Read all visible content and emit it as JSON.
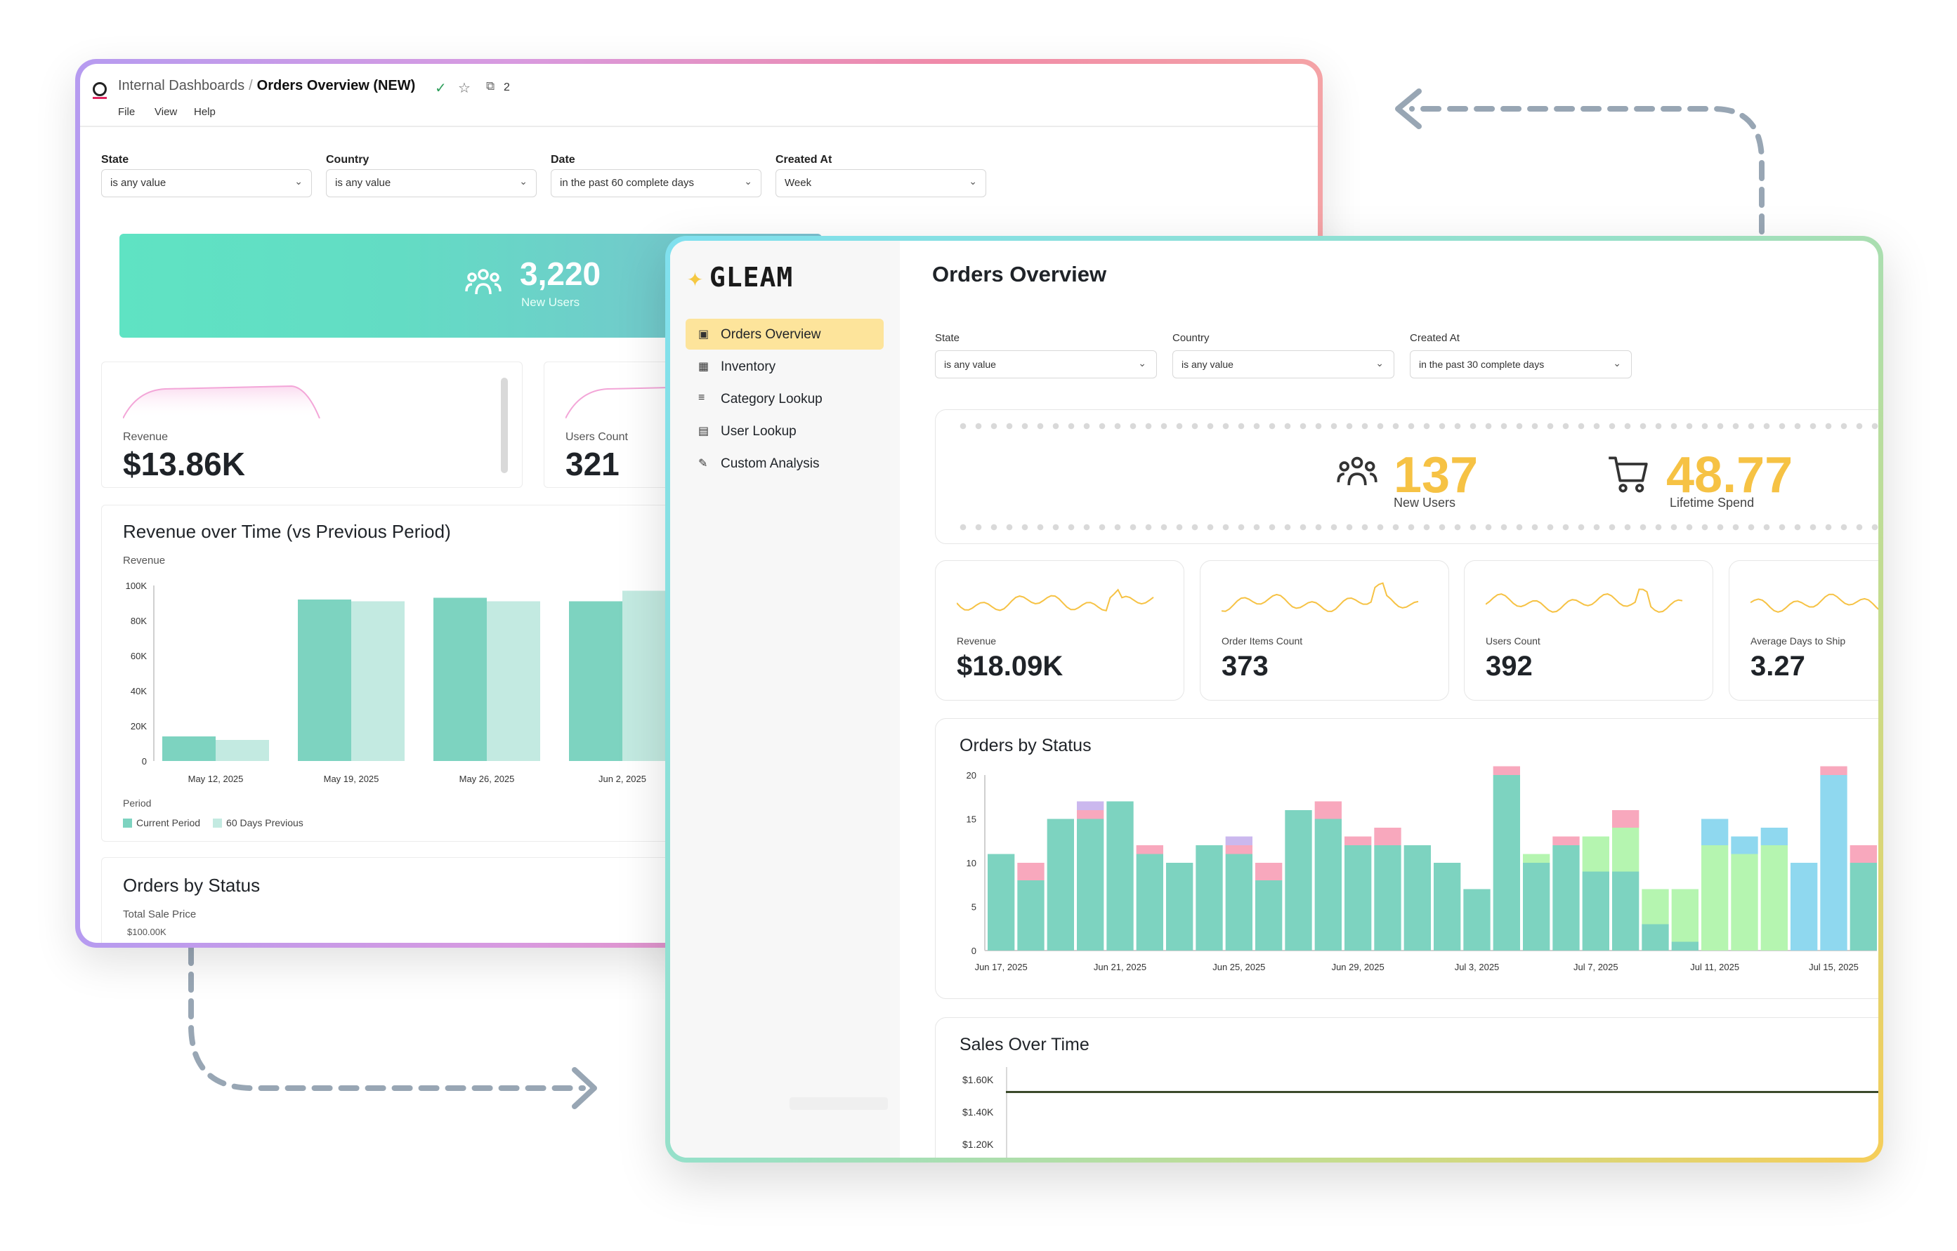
{
  "back_window": {
    "breadcrumb": {
      "parent": "Internal Dashboards",
      "separator": "/",
      "current": "Orders Overview (NEW)"
    },
    "tag_count": "2",
    "menu": [
      "File",
      "View",
      "Help"
    ],
    "filters": [
      {
        "label": "State",
        "value": "is any value"
      },
      {
        "label": "Country",
        "value": "is any value"
      },
      {
        "label": "Date",
        "value": "in the past 60 complete days"
      },
      {
        "label": "Created At",
        "value": "Week"
      }
    ],
    "hero": {
      "value": "3,220",
      "label": "New Users"
    },
    "kpis": [
      {
        "label": "Revenue",
        "value": "$13.86K"
      },
      {
        "label": "Users Count",
        "value": "321"
      }
    ],
    "revenue_chart": {
      "title": "Revenue over Time (vs Previous Period)",
      "ylabel": "Revenue",
      "legend_title": "Period"
    },
    "orders_panel": {
      "title": "Orders by Status",
      "subtitle": "Total Sale Price",
      "tick": "$100.00K"
    }
  },
  "front_window": {
    "brand": "GLEAM",
    "nav": [
      {
        "label": "Orders Overview",
        "icon": "document-icon",
        "active": true
      },
      {
        "label": "Inventory",
        "icon": "boxes-icon",
        "active": false
      },
      {
        "label": "Category Lookup",
        "icon": "list-search-icon",
        "active": false
      },
      {
        "label": "User Lookup",
        "icon": "user-doc-icon",
        "active": false
      },
      {
        "label": "Custom Analysis",
        "icon": "edit-icon",
        "active": false
      }
    ],
    "page_title": "Orders Overview",
    "filters": [
      {
        "label": "State",
        "value": "is any value"
      },
      {
        "label": "Country",
        "value": "is any value"
      },
      {
        "label": "Created At",
        "value": "in the past 30 complete days"
      }
    ],
    "hero": [
      {
        "value": "137",
        "label": "New Users",
        "icon": "users-icon"
      },
      {
        "value": "48.77",
        "label": "Lifetime Spend",
        "icon": "cart-icon"
      }
    ],
    "kpis": [
      {
        "label": "Revenue",
        "value": "$18.09K"
      },
      {
        "label": "Order Items Count",
        "value": "373"
      },
      {
        "label": "Users Count",
        "value": "392"
      },
      {
        "label": "Average Days to Ship",
        "value": "3.27"
      }
    ],
    "orders_panel": {
      "title": "Orders by Status"
    },
    "sales_panel": {
      "title": "Sales Over Time",
      "ticks": [
        "$1.60K",
        "$1.40K",
        "$1.20K"
      ]
    },
    "accent_color": "#f6c244"
  },
  "chart_data": [
    {
      "type": "bar",
      "title": "Revenue over Time (vs Previous Period)",
      "ylabel": "Revenue",
      "xlabel": "Period",
      "categories": [
        "May 12, 2025",
        "May 19, 2025",
        "May 26, 2025",
        "Jun 2, 2025"
      ],
      "ylim": [
        0,
        100000
      ],
      "yticks": [
        "0",
        "20K",
        "40K",
        "60K",
        "80K",
        "100K"
      ],
      "series": [
        {
          "name": "Current Period",
          "color": "#7dd3c0",
          "values": [
            14000,
            92000,
            93000,
            91000
          ]
        },
        {
          "name": "60 Days Previous",
          "color": "#c3eae1",
          "values": [
            12000,
            91000,
            91000,
            97000
          ]
        }
      ],
      "legend": "bottom-left"
    },
    {
      "type": "bar",
      "stacked": true,
      "title": "Orders by Status",
      "ylim": [
        0,
        20
      ],
      "yticks": [
        "0",
        "5",
        "10",
        "15",
        "20"
      ],
      "xtick_labels": [
        "Jun 17, 2025",
        "Jun 21, 2025",
        "Jun 25, 2025",
        "Jun 29, 2025",
        "Jul 3, 2025",
        "Jul 7, 2025",
        "Jul 11, 2025",
        "Jul 15, 2025"
      ],
      "segment_colors": [
        "#7dd3c0",
        "#b5f5b0",
        "#8fd8ef",
        "#f8a8bd",
        "#cbb8ee"
      ],
      "bars": [
        [
          11,
          0,
          0,
          0,
          0
        ],
        [
          8,
          0,
          0,
          2,
          0
        ],
        [
          15,
          0,
          0,
          0,
          0
        ],
        [
          15,
          0,
          0,
          1,
          1
        ],
        [
          17,
          0,
          0,
          0,
          0
        ],
        [
          11,
          0,
          0,
          1,
          0
        ],
        [
          10,
          0,
          0,
          0,
          0
        ],
        [
          12,
          0,
          0,
          0,
          0
        ],
        [
          11,
          0,
          0,
          1,
          1
        ],
        [
          8,
          0,
          0,
          2,
          0
        ],
        [
          16,
          0,
          0,
          0,
          0
        ],
        [
          15,
          0,
          0,
          2,
          0
        ],
        [
          12,
          0,
          0,
          1,
          0
        ],
        [
          12,
          0,
          0,
          2,
          0
        ],
        [
          12,
          0,
          0,
          0,
          0
        ],
        [
          10,
          0,
          0,
          0,
          0
        ],
        [
          7,
          0,
          0,
          0,
          0
        ],
        [
          20,
          0,
          0,
          1,
          0
        ],
        [
          10,
          1,
          0,
          0,
          0
        ],
        [
          12,
          0,
          0,
          1,
          0
        ],
        [
          9,
          4,
          0,
          0,
          0
        ],
        [
          9,
          5,
          0,
          2,
          0
        ],
        [
          3,
          4,
          0,
          0,
          0
        ],
        [
          1,
          6,
          0,
          0,
          0
        ],
        [
          0,
          12,
          3,
          0,
          0
        ],
        [
          0,
          11,
          2,
          0,
          0
        ],
        [
          0,
          12,
          2,
          0,
          0
        ],
        [
          0,
          0,
          10,
          0,
          0
        ],
        [
          0,
          0,
          20,
          1,
          0
        ],
        [
          10,
          0,
          0,
          2,
          0
        ]
      ],
      "legend": "right"
    },
    {
      "type": "line",
      "title": "Sales Over Time",
      "yticks": [
        "$1.60K",
        "$1.40K",
        "$1.20K"
      ]
    }
  ]
}
